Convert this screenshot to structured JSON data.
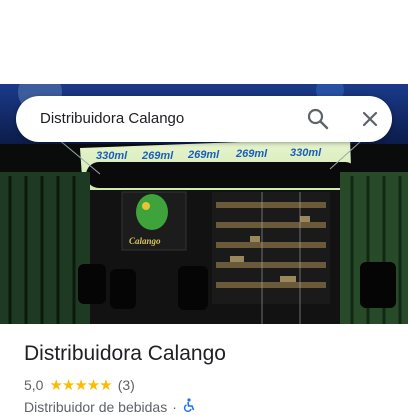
{
  "search": {
    "query": "Distribuidora Calango"
  },
  "photo": {
    "sign_text": "Calango",
    "banner_prices": [
      "330ml",
      "269ml",
      "269ml",
      "269ml",
      "330ml"
    ]
  },
  "place": {
    "title": "Distribuidora Calango",
    "rating": "5,0",
    "stars": "★★★★★",
    "review_count": "(3)",
    "category": "Distribuidor de bebidas",
    "separator": "·"
  },
  "icons": {
    "search": "search-icon",
    "close": "close-icon",
    "accessibility": "wheelchair-icon"
  },
  "colors": {
    "star": "#fbbc04",
    "accessibility": "#1a73e8",
    "banner": "#27a8e0"
  }
}
